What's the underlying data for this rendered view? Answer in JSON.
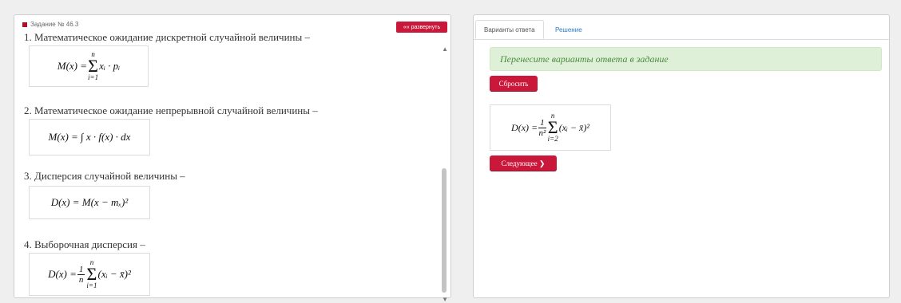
{
  "left": {
    "task_label": "Задание № 46.3",
    "expand_label": "«« развернуть",
    "items": [
      {
        "text": "1. Математическое ожидание дискретной случайной величины –"
      },
      {
        "text": "2. Математическое ожидание непрерывной случайной величины –"
      },
      {
        "text": "3. Дисперсия случайной величины –"
      },
      {
        "text": "4. Выборочная дисперсия –"
      }
    ],
    "formulas": {
      "f1": {
        "lhs": "M(x) =",
        "sum_top": "n",
        "sum_bottom": "i=1",
        "body": "xᵢ · pᵢ"
      },
      "f2": {
        "text": "M(x) = ∫ x · f(x) · dx"
      },
      "f3": {
        "text": "D(x) = M(x − mₓ)²"
      },
      "f4": {
        "lhs": "D(x) =",
        "frac_num": "1",
        "frac_den": "n",
        "sum_top": "n",
        "sum_bottom": "i=1",
        "body": "(xᵢ − x̄)²"
      }
    }
  },
  "right": {
    "tabs": [
      "Варианты ответа",
      "Решение"
    ],
    "hint": "Перенесите варианты ответа в задание",
    "reset_label": "Сбросить",
    "next_label": "Следующее ❯",
    "answer": {
      "lhs": "D(x) =",
      "frac_num": "1",
      "frac_den": "n²",
      "sum_top": "n",
      "sum_bottom": "i=2",
      "body": "(xᵢ − x̄)²"
    }
  },
  "colors": {
    "accent": "#c9183a",
    "hint_bg": "#dff0d8",
    "link": "#2a7bc0"
  }
}
